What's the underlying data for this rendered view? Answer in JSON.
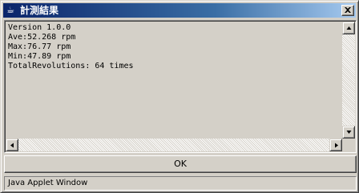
{
  "window": {
    "title": "計測結果",
    "title_icon": "java-applet-icon",
    "title_icon_glyph": "☕"
  },
  "content": {
    "lines": [
      "Version 1.0.0",
      "Ave:52.268 rpm",
      "Max:76.77 rpm",
      "Min:47.89 rpm",
      "TotalRevolutions: 64 times"
    ]
  },
  "buttons": {
    "ok_label": "OK"
  },
  "statusbar": {
    "text": "Java Applet Window"
  },
  "colors": {
    "titlebar_start": "#0a246a",
    "titlebar_end": "#a6caf0",
    "face": "#d4d0c8"
  }
}
